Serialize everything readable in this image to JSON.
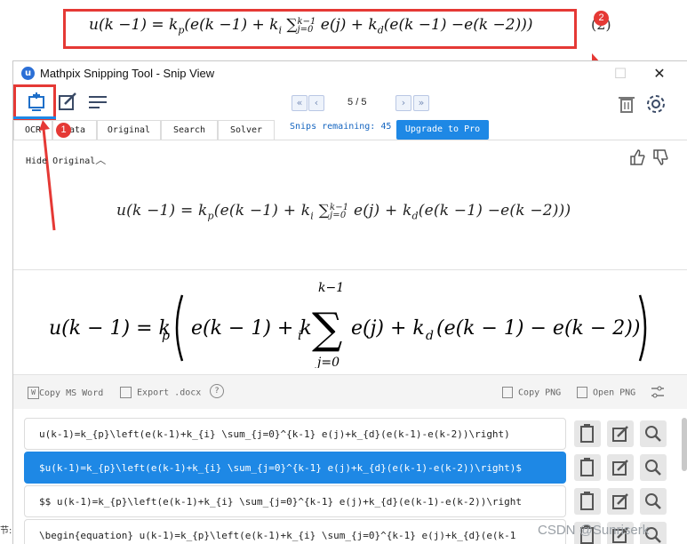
{
  "document": {
    "equation": "u(k −1) = k",
    "equation_full": "u(k −1) = kp(e(k −1) + ki ∑j=0k−1 e(j) + kd(e(k −1) −e(k −2)))",
    "equation_number": "(2)"
  },
  "window": {
    "title": "Mathpix Snipping Tool - Snip View",
    "app_icon_letter": "u"
  },
  "pager": {
    "current": "5",
    "separator": "/",
    "total": "5"
  },
  "tabs": [
    {
      "label": "OCR"
    },
    {
      "label": "Data"
    },
    {
      "label": "Original"
    },
    {
      "label": "Search"
    },
    {
      "label": "Solver"
    }
  ],
  "snips_remaining": "Snips remaining: 45",
  "upgrade_label": "Upgrade to Pro",
  "hide_original_label": "Hide Original",
  "actions": {
    "copy_ms_word": "Copy MS Word",
    "export_docx": "Export .docx",
    "copy_png": "Copy PNG",
    "open_png": "Open PNG"
  },
  "results": [
    "u(k-1)=k_{p}\\left(e(k-1)+k_{i} \\sum_{j=0}^{k-1} e(j)+k_{d}(e(k-1)-e(k-2))\\right)",
    "$u(k-1)=k_{p}\\left(e(k-1)+k_{i} \\sum_{j=0}^{k-1} e(j)+k_{d}(e(k-1)-e(k-2))\\right)$",
    "$$  u(k-1)=k_{p}\\left(e(k-1)+k_{i} \\sum_{j=0}^{k-1} e(j)+k_{d}(e(k-1)-e(k-2))\\right",
    "\\begin{equation}  u(k-1)=k_{p}\\left(e(k-1)+k_{i} \\sum_{j=0}^{k-1} e(j)+k_{d}(e(k-1"
  ],
  "annotations": {
    "badge_1": "1",
    "badge_2": "2"
  },
  "watermark": "CSDN @Sunriserk",
  "left_clip_text": "节:",
  "colors": {
    "accent": "#1e88e5",
    "annotation": "#e53935",
    "snips_text": "#1565c0"
  }
}
